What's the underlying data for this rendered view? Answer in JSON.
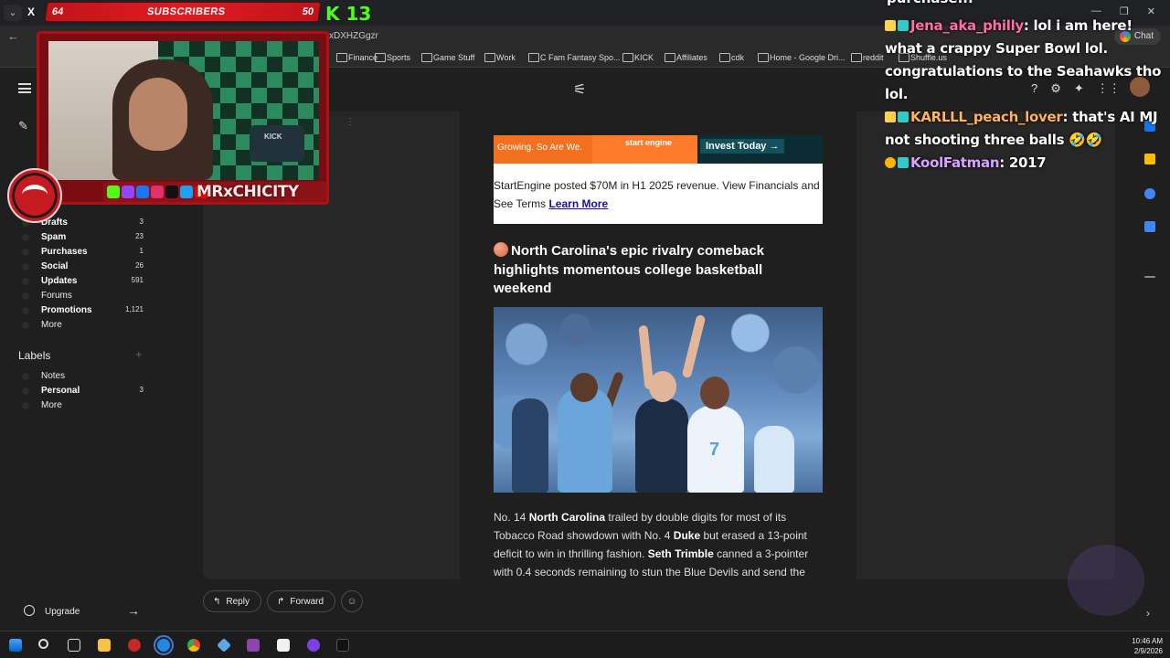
{
  "browser": {
    "tab_text": "X",
    "url_fragment": "xDXHZGgzr",
    "chat_button": "Chat",
    "bookmarks": [
      "Finance",
      "Sports",
      "Game Stuff",
      "Work",
      "C Fam Fantasy Spo...",
      "KICK",
      "Affiliates",
      "cdk",
      "Home - Google Dri...",
      "reddit",
      "Shuffle.us"
    ]
  },
  "overlay": {
    "sub_left": "64",
    "sub_label": "SUBSCRIBERS",
    "sub_right": "50",
    "kick_count": "13",
    "streamer_handle": "MRxCHICITY",
    "shirt_text": "KICK"
  },
  "chat": {
    "partial_line": "purchase...",
    "messages": [
      {
        "user": "Jena_aka_philly",
        "user_color": "#ff6fa1",
        "badge_color": "#ffd34d",
        "text": ": lol i am here! what a crappy Super Bowl lol. congratulations to the Seahawks tho lol."
      },
      {
        "user": "KARLLL_peach_lover",
        "user_color": "#ffb35c",
        "badge_color": "#ffd34d",
        "text": ": that's AI MJ not shooting three balls 🤣🤣"
      },
      {
        "user": "KoolFatman",
        "user_color": "#d7a4ff",
        "badge_color": "#ffb400",
        "text": ": 2017"
      }
    ]
  },
  "sidebar": {
    "items": [
      {
        "label": "Drafts",
        "count": "3",
        "bold": true
      },
      {
        "label": "Spam",
        "count": "23",
        "bold": true
      },
      {
        "label": "Purchases",
        "count": "1",
        "bold": true
      },
      {
        "label": "Social",
        "count": "26",
        "bold": true
      },
      {
        "label": "Updates",
        "count": "591",
        "bold": true
      },
      {
        "label": "Forums",
        "count": "",
        "bold": false
      },
      {
        "label": "Promotions",
        "count": "1,121",
        "bold": true
      },
      {
        "label": "More",
        "count": "",
        "bold": false
      }
    ],
    "labels_heading": "Labels",
    "labels": [
      {
        "label": "Notes",
        "count": "",
        "bold": false
      },
      {
        "label": "Personal",
        "count": "3",
        "bold": true
      },
      {
        "label": "More",
        "count": "",
        "bold": false
      }
    ],
    "upgrade": "Upgrade"
  },
  "email": {
    "ad": {
      "left_text": "Growing. So Are We.",
      "logo": "start engine",
      "cta": "Invest Today →",
      "caption": "StartEngine posted $70M in H1 2025 revenue. View Financials and See Terms ",
      "link": "Learn More"
    },
    "headline": "North Carolina's epic rivalry comeback highlights momentous college basketball weekend",
    "jersey_number": "7",
    "article": {
      "t1": "No. 14 ",
      "b1": "North Carolina",
      "t2": " trailed by double digits for most of its Tobacco Road showdown with No. 4 ",
      "b2": "Duke",
      "t3": " but erased a 13-point deficit to win in thrilling fashion. ",
      "b3": "Seth Trimble",
      "t4": " canned a 3-pointer with 0.4 seconds remaining to stun the Blue Devils and send the"
    }
  },
  "actions": {
    "reply": "Reply",
    "forward": "Forward"
  },
  "taskbar": {
    "time": "10:46 AM",
    "date": "2/9/2026"
  }
}
